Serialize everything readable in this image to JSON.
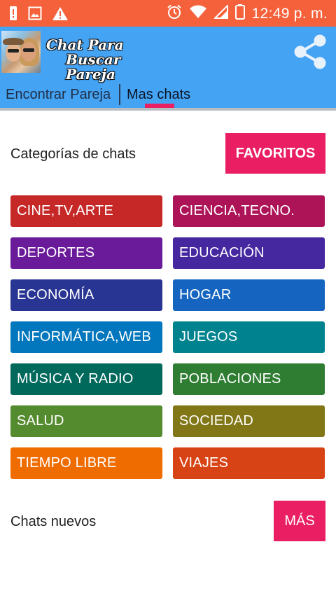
{
  "status_bar": {
    "time": "12:49 p. m.",
    "background": "#f4613b",
    "left_icons": [
      "battery-alert-icon",
      "image-icon",
      "warning-icon"
    ],
    "right_icons": [
      "alarm-icon",
      "wifi-icon",
      "signal-icon",
      "battery-icon"
    ]
  },
  "app_bar": {
    "title_line1": "Chat Para",
    "title_line2": "Buscar Pareja",
    "background": "#45a3f4",
    "share_icon": "share-icon",
    "tabs": [
      {
        "label": "Encontrar Pareja",
        "selected": false
      },
      {
        "label": "Mas chats",
        "selected": true
      }
    ],
    "indicator_color": "#e91e63"
  },
  "categories_section": {
    "label": "Categorías de chats",
    "favorites_button": "FAVORITOS",
    "items": [
      {
        "label": "CINE,TV,ARTE",
        "color": "#c62828"
      },
      {
        "label": "CIENCIA,TECNO.",
        "color": "#ad1457"
      },
      {
        "label": "DEPORTES",
        "color": "#6a1b9a"
      },
      {
        "label": "EDUCACIÓN",
        "color": "#4527a0"
      },
      {
        "label": "ECONOMÍA",
        "color": "#283593"
      },
      {
        "label": "HOGAR",
        "color": "#1565c0"
      },
      {
        "label": "INFORMÁTICA,WEB",
        "color": "#0277bd"
      },
      {
        "label": "JUEGOS",
        "color": "#00838f"
      },
      {
        "label": "MÚSICA Y RADIO",
        "color": "#00695c"
      },
      {
        "label": "POBLACIONES",
        "color": "#2e7d32"
      },
      {
        "label": "SALUD",
        "color": "#558b2f"
      },
      {
        "label": "SOCIEDAD",
        "color": "#827717"
      },
      {
        "label": "TIEMPO LIBRE",
        "color": "#ef6c00"
      },
      {
        "label": "VIAJES",
        "color": "#d84315"
      }
    ]
  },
  "new_chats_section": {
    "label": "Chats nuevos",
    "more_button": "MÁS"
  }
}
